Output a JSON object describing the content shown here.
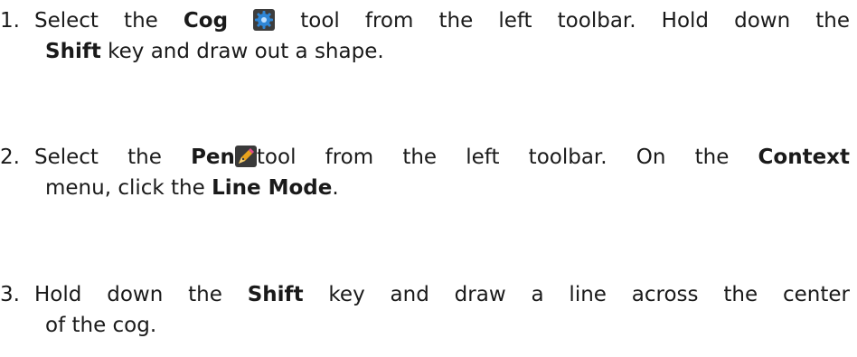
{
  "steps": [
    {
      "number": "1.",
      "t1": "Select the ",
      "b1": "Cog",
      "t2": " tool from the left toolbar. Hold down the",
      "b2": "Shift",
      "t3": " key and draw out a shape.",
      "icon": "cog-icon",
      "icon_color": "#2f86d6"
    },
    {
      "number": "2.",
      "t1": "Select the ",
      "b1": "Pen",
      "t2": "tool from the left toolbar. On the ",
      "b2": "Context",
      "t3": "menu, click the ",
      "b3": "Line Mode",
      "t4": ".",
      "icon": "pen-icon",
      "icon_color": "#e8a21c"
    },
    {
      "number": "3.",
      "t1": "Hold down the ",
      "b1": "Shift",
      "t2": " key and draw a line across the center",
      "t3": "of  the cog."
    }
  ]
}
